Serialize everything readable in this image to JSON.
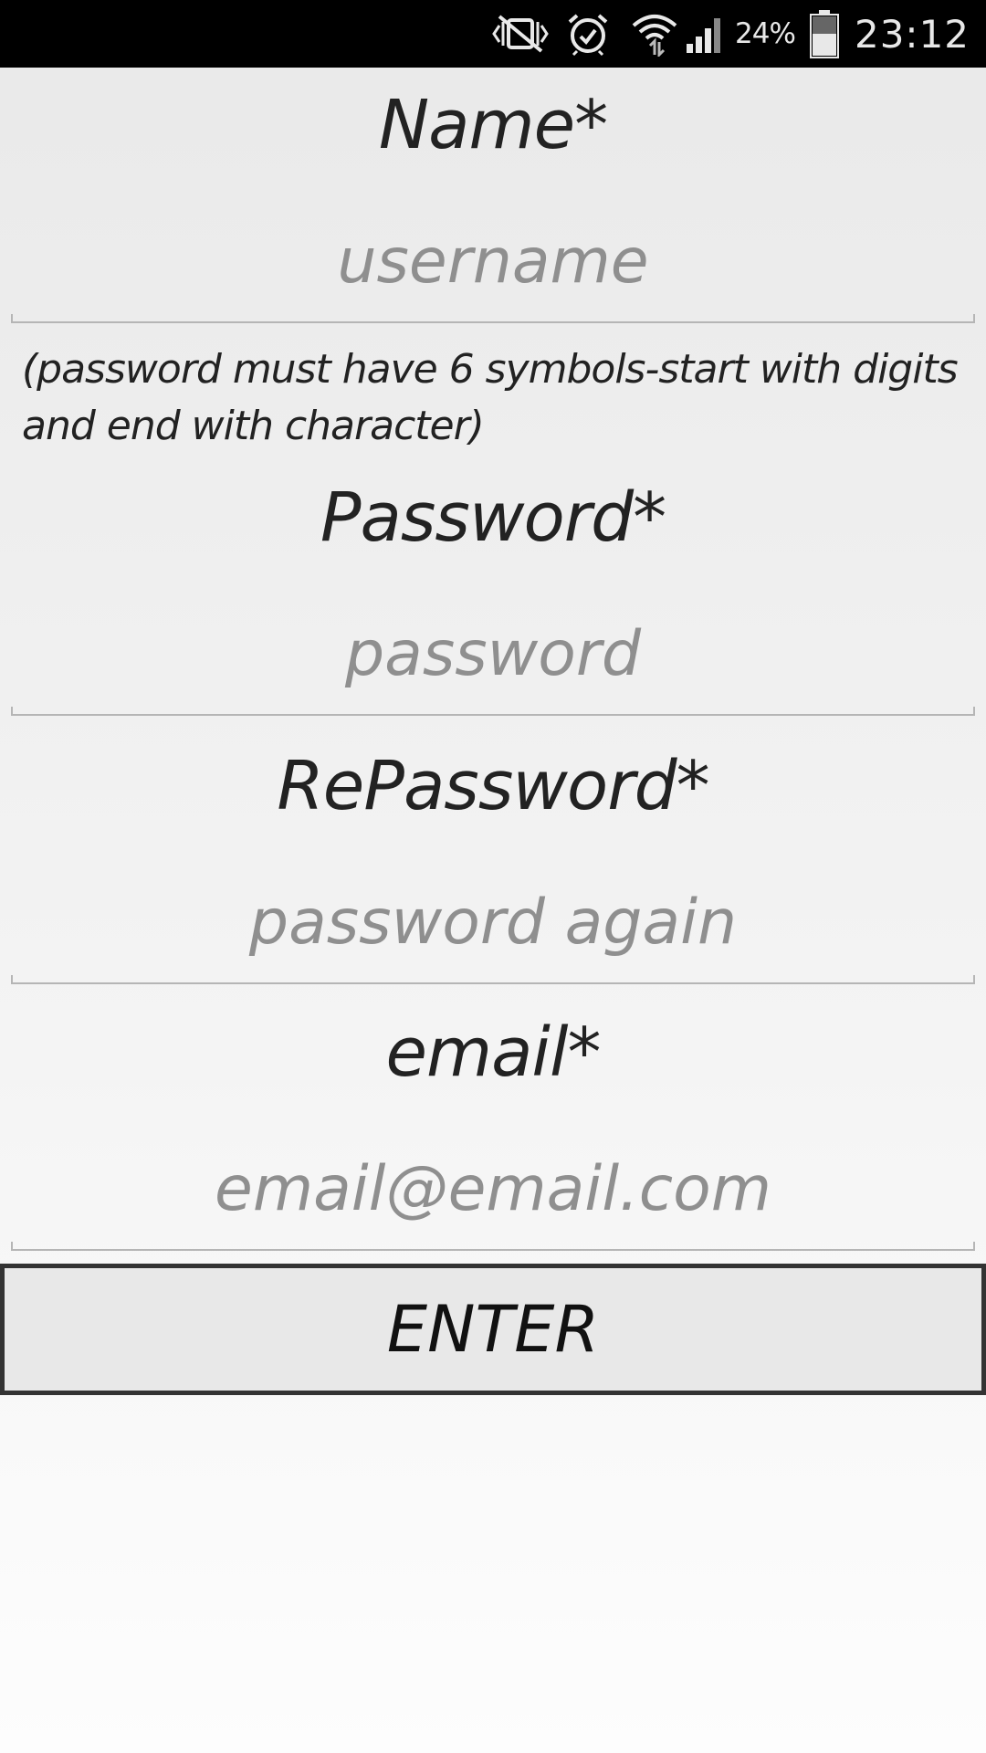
{
  "status_bar": {
    "icons": [
      "mute-vibrate-icon",
      "alarm-icon",
      "wifi-icon",
      "signal-icon",
      "battery-icon"
    ],
    "battery_percent": "24%",
    "time": "23:12"
  },
  "form": {
    "name": {
      "label": "Name*",
      "placeholder": "username"
    },
    "password_hint": "(password must have 6 symbols-start with digits and end with character)",
    "password": {
      "label": "Password*",
      "placeholder": "password"
    },
    "repassword": {
      "label": "RePassword*",
      "placeholder": "password again"
    },
    "email": {
      "label": "email*",
      "placeholder": "email@email.com"
    },
    "submit_label": "ENTER"
  },
  "colors": {
    "status_bar_bg": "#000000",
    "label_text": "#222222",
    "placeholder_text": "#8f8f8f",
    "button_border": "#333333",
    "button_bg": "#e8e8e8"
  }
}
